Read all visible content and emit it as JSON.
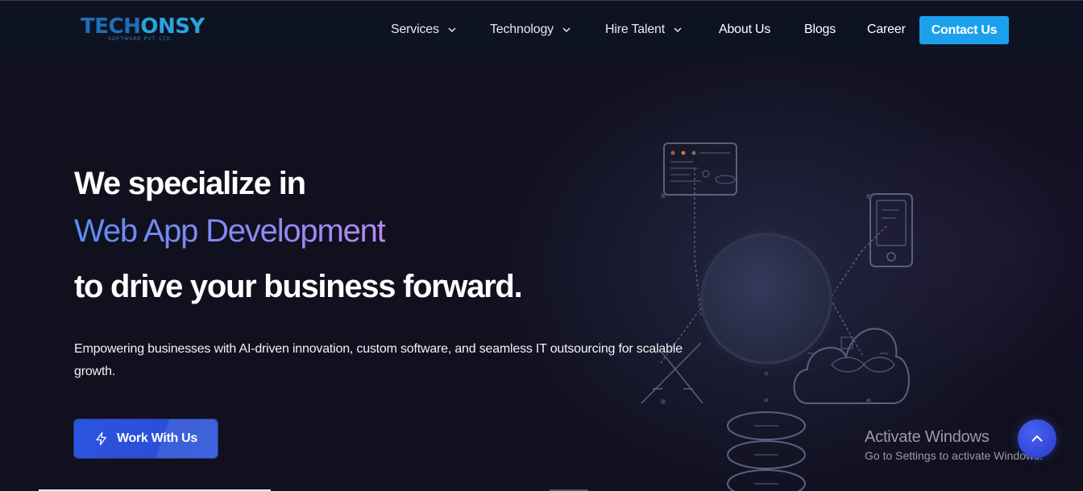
{
  "logo": {
    "part1": "TECH",
    "part2": "ONSY",
    "tagline": "SOFTWARE PVT. LTD."
  },
  "nav": {
    "items": [
      {
        "label": "Services",
        "has_dropdown": true
      },
      {
        "label": "Technology",
        "has_dropdown": true
      },
      {
        "label": "Hire Talent",
        "has_dropdown": true
      },
      {
        "label": "About Us",
        "has_dropdown": false
      },
      {
        "label": "Blogs",
        "has_dropdown": false
      },
      {
        "label": "Career",
        "has_dropdown": false
      }
    ],
    "contact_label": "Contact Us"
  },
  "hero": {
    "line1": "We specialize in",
    "line2": "Web App Development",
    "line3": "to drive your business forward.",
    "description": "Empowering businesses with AI-driven innovation, custom software, and seamless IT outsourcing for scalable growth.",
    "cta_label": "Work With Us"
  },
  "watermark": {
    "title": "Activate Windows",
    "subtitle": "Go to Settings to activate Windows."
  },
  "colors": {
    "accent": "#1ca0ec",
    "cta": "#2d54e0",
    "background": "#10101f",
    "gradient_start": "#5b8ff0",
    "gradient_end": "#b58cf0"
  }
}
